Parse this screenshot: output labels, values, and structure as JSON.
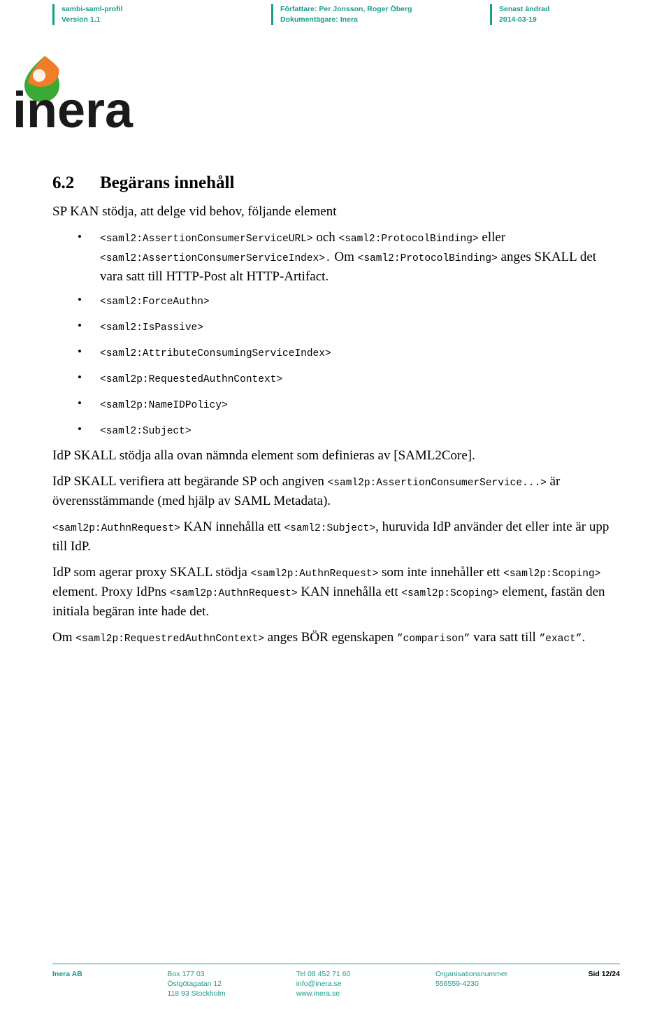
{
  "header": {
    "col1_line1": "sambi-saml-profil",
    "col1_line2": "Version 1.1",
    "col2_line1": "Författare: Per Jonsson, Roger Öberg",
    "col2_line2": "Dokumentägare: Inera",
    "col3_line1": "Senast ändrad",
    "col3_line2": "2014-03-19"
  },
  "logo": {
    "wordmark": "inera",
    "accent_color": "#f07d28",
    "green_color": "#3aa935",
    "teal_color": "#1a9c8c"
  },
  "section": {
    "number": "6.2",
    "title": "Begärans innehåll",
    "intro": "SP KAN stödja, att delge vid behov, följande element"
  },
  "bullets": [
    {
      "parts": [
        {
          "t": "<saml2:AssertionConsumerServiceURL>",
          "s": "mono"
        },
        {
          "t": " och ",
          "s": "body"
        },
        {
          "t": "<saml2:ProtocolBinding>",
          "s": "mono"
        },
        {
          "t": " eller ",
          "s": "body"
        },
        {
          "t": "<saml2:AssertionConsumerServiceIndex>.",
          "s": "mono"
        },
        {
          "t": " Om ",
          "s": "body"
        },
        {
          "t": "<saml2:ProtocolBinding>",
          "s": "mono"
        },
        {
          "t": " anges SKALL det vara satt till HTTP-Post alt HTTP-Artifact.",
          "s": "body"
        }
      ]
    },
    {
      "parts": [
        {
          "t": "<saml2:ForceAuthn>",
          "s": "mono"
        }
      ]
    },
    {
      "parts": [
        {
          "t": "<saml2:IsPassive>",
          "s": "mono"
        }
      ]
    },
    {
      "parts": [
        {
          "t": "<saml2:AttributeConsumingServiceIndex>",
          "s": "mono"
        }
      ]
    },
    {
      "parts": [
        {
          "t": "<saml2p:RequestedAuthnContext>",
          "s": "mono"
        }
      ]
    },
    {
      "parts": [
        {
          "t": "<saml2p:NameIDPolicy>",
          "s": "mono"
        }
      ]
    },
    {
      "parts": [
        {
          "t": "<saml2:Subject>",
          "s": "mono"
        }
      ]
    }
  ],
  "paragraphs": [
    {
      "id": "p1",
      "parts": [
        {
          "t": "IdP SKALL stödja alla ovan nämnda element som definieras av [SAML2Core].",
          "s": "body"
        }
      ]
    },
    {
      "id": "p2",
      "parts": [
        {
          "t": "IdP SKALL verifiera att begärande SP och angiven ",
          "s": "body"
        },
        {
          "t": "<saml2p:AssertionConsumerService...>",
          "s": "mono"
        },
        {
          "t": " är överensstämmande (med hjälp av SAML Metadata).",
          "s": "body"
        }
      ]
    },
    {
      "id": "p3",
      "parts": [
        {
          "t": "<saml2p:AuthnRequest>",
          "s": "mono"
        },
        {
          "t": " KAN innehålla ett ",
          "s": "body"
        },
        {
          "t": "<saml2:Subject>",
          "s": "mono"
        },
        {
          "t": ", huruvida IdP använder det eller inte är upp till IdP.",
          "s": "body"
        }
      ]
    },
    {
      "id": "p4",
      "parts": [
        {
          "t": "IdP som agerar proxy SKALL stödja ",
          "s": "body"
        },
        {
          "t": "<saml2p:AuthnRequest>",
          "s": "mono"
        },
        {
          "t": " som inte innehåller ett ",
          "s": "body"
        },
        {
          "t": "<saml2p:Scoping>",
          "s": "mono"
        },
        {
          "t": " element. Proxy IdPns ",
          "s": "body"
        },
        {
          "t": "<saml2p:AuthnRequest>",
          "s": "mono"
        },
        {
          "t": " KAN innehålla ett ",
          "s": "body"
        },
        {
          "t": "<saml2p:Scoping>",
          "s": "mono"
        },
        {
          "t": " element, fastän den initiala begäran inte hade det.",
          "s": "body"
        }
      ]
    },
    {
      "id": "p5",
      "parts": [
        {
          "t": "Om ",
          "s": "body"
        },
        {
          "t": "<saml2p:RequestredAuthnContext>",
          "s": "mono"
        },
        {
          "t": " anges BÖR egenskapen ",
          "s": "body"
        },
        {
          "t": "”comparison”",
          "s": "mono"
        },
        {
          "t": " vara satt till ",
          "s": "body"
        },
        {
          "t": "”exact”",
          "s": "mono"
        },
        {
          "t": ".",
          "s": "body"
        }
      ]
    }
  ],
  "footer": {
    "col1": [
      "Inera AB"
    ],
    "col2": [
      "Box 177 03",
      "Östgötagatan 12",
      "118 93 Stockholm"
    ],
    "col3": [
      "Tel 08 452 71 60",
      "info@inera.se",
      "www.inera.se"
    ],
    "col4": [
      "Organisationsnummer",
      "556559-4230"
    ],
    "col5": [
      "Sid 12/24"
    ]
  }
}
